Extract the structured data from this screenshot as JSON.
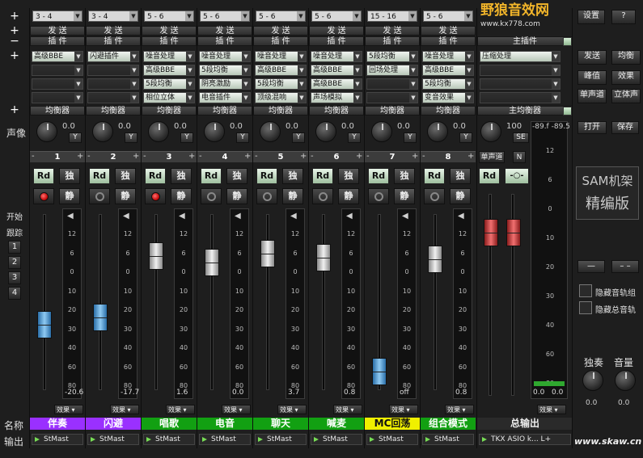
{
  "top_combos": [
    "3 - 4",
    "3 - 4",
    "5 - 6",
    "5 - 6",
    "5 - 6",
    "5 - 6",
    "15 - 16",
    "5 - 6"
  ],
  "top_buttons": {
    "settings": "设置",
    "help": "?"
  },
  "logo": {
    "text": "野狼音效网",
    "url": "www.kx778.com"
  },
  "row_labels": {
    "send": "发 送",
    "plugin": "插 件",
    "main_plugin": "主插件",
    "eq": "均衡器",
    "main_eq": "主均衡器"
  },
  "left_labels": {
    "pan": "声像",
    "start": "开始",
    "track": "跟踪",
    "name": "名称",
    "output": "输出",
    "plus": "+",
    "minus": "−"
  },
  "track_numbers": [
    "1",
    "2",
    "3",
    "4"
  ],
  "plugins": [
    [
      "高级BBE",
      "",
      "",
      ""
    ],
    [
      "闪避插件",
      "",
      "",
      ""
    ],
    [
      "噪音处理",
      "高级BBE",
      "5段均衡",
      "相位立体"
    ],
    [
      "噪音处理",
      "5段均衡",
      "阴亮激励",
      "电音插件"
    ],
    [
      "噪音处理",
      "高级BBE",
      "5段均衡",
      "顶级混响"
    ],
    [
      "噪音处理",
      "高级BBE",
      "高级BBE",
      "声场模拟"
    ],
    [
      "5段均衡",
      "回场处理",
      "",
      ""
    ],
    [
      "噪音处理",
      "高级BBE",
      "5段均衡",
      "变音效果"
    ]
  ],
  "master_plugin": "压缩处理",
  "right_buttons": {
    "send": "发送",
    "eq": "均衡",
    "peak": "峰值",
    "effect": "效果",
    "mono": "单声道",
    "stereo": "立体声",
    "open": "打开",
    "save": "保存",
    "dash1": "—",
    "dash2": "– –"
  },
  "channels": [
    {
      "num": "1",
      "pan": "0.0",
      "y": "Y",
      "rd": "Rd",
      "solo": "独",
      "mute": "静",
      "peak": "-20.6",
      "eff": "效果",
      "name": "伴奏",
      "color": "#9a30ff",
      "text_color": "#ffffff",
      "out": "StMast",
      "fader": 0.65,
      "fader_color": "blue",
      "rec": "on"
    },
    {
      "num": "2",
      "pan": "0.0",
      "y": "Y",
      "rd": "Rd",
      "solo": "独",
      "mute": "静",
      "peak": "-17.7",
      "eff": "效果",
      "name": "闪避",
      "color": "#9a30ff",
      "text_color": "#ffffff",
      "out": "StMast",
      "fader": 0.6,
      "fader_color": "blue",
      "rec": "off"
    },
    {
      "num": "3",
      "pan": "0.0",
      "y": "Y",
      "rd": "Rd",
      "solo": "独",
      "mute": "静",
      "peak": "1.6",
      "eff": "效果",
      "name": "唱歌",
      "color": "#12a012",
      "text_color": "#ffffff",
      "out": "StMast",
      "fader": 0.18,
      "fader_color": "grey",
      "rec": "on"
    },
    {
      "num": "4",
      "pan": "0.0",
      "y": "Y",
      "rd": "Rd",
      "solo": "独",
      "mute": "静",
      "peak": "0.0",
      "eff": "效果",
      "name": "电音",
      "color": "#12a012",
      "text_color": "#ffffff",
      "out": "StMast",
      "fader": 0.22,
      "fader_color": "grey",
      "rec": "off"
    },
    {
      "num": "5",
      "pan": "0.0",
      "y": "Y",
      "rd": "Rd",
      "solo": "独",
      "mute": "静",
      "peak": "3.7",
      "eff": "效果",
      "name": "聊天",
      "color": "#12a012",
      "text_color": "#ffffff",
      "out": "StMast",
      "fader": 0.16,
      "fader_color": "grey",
      "rec": "off"
    },
    {
      "num": "6",
      "pan": "0.0",
      "y": "Y",
      "rd": "Rd",
      "solo": "独",
      "mute": "静",
      "peak": "0.8",
      "eff": "效果",
      "name": "喊麦",
      "color": "#12a012",
      "text_color": "#ffffff",
      "out": "StMast",
      "fader": 0.19,
      "fader_color": "grey",
      "rec": "off"
    },
    {
      "num": "7",
      "pan": "0.0",
      "y": "Y",
      "rd": "Rd",
      "solo": "独",
      "mute": "静",
      "peak": "off",
      "eff": "效果",
      "name": "MC回荡",
      "color": "#f0f000",
      "text_color": "#111111",
      "out": "StMast",
      "fader": 0.97,
      "fader_color": "blue",
      "rec": "off"
    },
    {
      "num": "8",
      "pan": "0.0",
      "y": "Y",
      "rd": "Rd",
      "solo": "独",
      "mute": "静",
      "peak": "0.8",
      "eff": "效果",
      "name": "组合模式",
      "color": "#12a012",
      "text_color": "#ffffff",
      "out": "StMast",
      "fader": 0.2,
      "fader_color": "grey",
      "rec": "off"
    }
  ],
  "master": {
    "pan": "100",
    "se": "SE",
    "mono": "单声道",
    "n": "N",
    "rd": "Rd",
    "name": "总输出",
    "out": "TKX ASIO k... L+",
    "eff": "效果",
    "peak_l": "0.0",
    "peak_r": "0.0",
    "readout": "-89.f -89.5",
    "fader": 0.13
  },
  "sam": {
    "line1": "SAM机架",
    "line2": "精编版"
  },
  "checkboxes": [
    "隐藏音轨组",
    "隐藏总音轨"
  ],
  "solo_label": "独奏",
  "volume_label": "音量",
  "solo_val": "0.0",
  "volume_val": "0.0",
  "meter_ticks": [
    "12",
    "6",
    "0",
    "10",
    "20",
    "30",
    "40",
    "60",
    "80"
  ],
  "watermark": "www.skaw.cn"
}
